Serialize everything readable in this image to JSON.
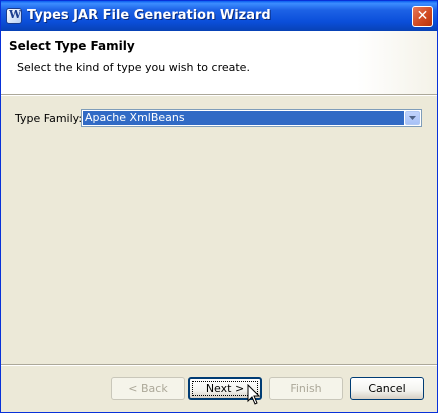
{
  "window": {
    "title": "Types JAR File Generation Wizard",
    "close_label": "✕"
  },
  "header": {
    "title": "Select Type Family",
    "description": "Select the kind of type you wish to create."
  },
  "form": {
    "type_family_label": "Type Family:",
    "type_family_value": "Apache XmlBeans"
  },
  "buttons": {
    "back": "< Back",
    "next": "Next >",
    "finish": "Finish",
    "cancel": "Cancel"
  },
  "icons": {
    "app": "wizard-app-icon",
    "close": "close-icon",
    "dropdown": "chevron-down-icon",
    "cursor": "mouse-pointer-icon"
  },
  "colors": {
    "titlebar": "#0A4ED9",
    "selection": "#316AC5",
    "dialog_bg": "#ECE9D8"
  }
}
